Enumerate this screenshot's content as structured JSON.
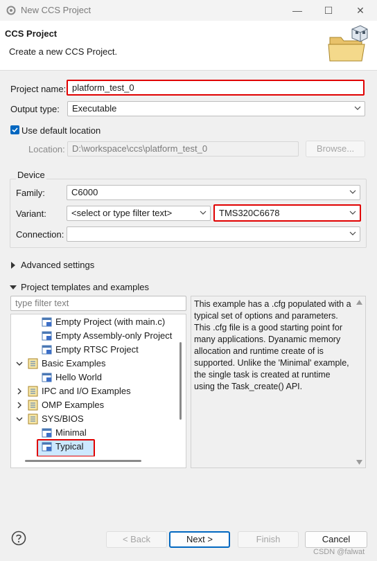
{
  "window": {
    "title": "New CCS Project",
    "minimize_label": "—",
    "maximize_label": "☐",
    "close_label": "✕",
    "app_icon": "eclipse-gear-icon"
  },
  "header": {
    "title": "CCS Project",
    "subtitle": "Create a new CCS Project.",
    "banner_icon": "folder-cube-icon"
  },
  "project": {
    "name_label": "Project name:",
    "name_value": "platform_test_0",
    "output_type_label": "Output type:",
    "output_type_value": "Executable",
    "use_default_location_label": "Use default location",
    "use_default_location_checked": true,
    "location_label": "Location:",
    "location_value": "D:\\workspace\\ccs\\platform_test_0",
    "browse_label": "Browse..."
  },
  "device": {
    "group_label": "Device",
    "family_label": "Family:",
    "family_value": "C6000",
    "variant_label": "Variant:",
    "variant_filter_placeholder": "<select or type filter text>",
    "variant_value": "TMS320C6678",
    "connection_label": "Connection:",
    "connection_value": ""
  },
  "sections": {
    "advanced_settings": "Advanced settings",
    "templates": "Project templates and examples"
  },
  "templates": {
    "filter_placeholder": "type filter text",
    "items": [
      {
        "label": "Empty Project (with main.c)",
        "kind": "leaf",
        "depth": 2
      },
      {
        "label": "Empty Assembly-only Project",
        "kind": "leaf",
        "depth": 2
      },
      {
        "label": "Empty RTSC Project",
        "kind": "leaf",
        "depth": 2
      },
      {
        "label": "Basic Examples",
        "kind": "folder",
        "depth": 1,
        "expanded": true
      },
      {
        "label": "Hello World",
        "kind": "leaf",
        "depth": 2
      },
      {
        "label": "IPC and I/O Examples",
        "kind": "folder",
        "depth": 1,
        "expanded": false
      },
      {
        "label": "OMP Examples",
        "kind": "folder",
        "depth": 1,
        "expanded": false
      },
      {
        "label": "SYS/BIOS",
        "kind": "folder",
        "depth": 1,
        "expanded": true
      },
      {
        "label": "Minimal",
        "kind": "leaf",
        "depth": 2
      },
      {
        "label": "Typical",
        "kind": "leaf",
        "depth": 2,
        "selected": true
      }
    ],
    "description": "This example has a .cfg populated with a typical set of options and parameters.  This .cfg file is a good starting point for many applications. Dyanamic memory allocation and runtime create of is supported.  Unlike the 'Minimal' example, the single task is created at runtime using the Task_create() API."
  },
  "footer": {
    "help_icon": "help-question-icon",
    "back_label": "< Back",
    "next_label": "Next >",
    "finish_label": "Finish",
    "cancel_label": "Cancel",
    "watermark": "CSDN @falwat"
  },
  "colors": {
    "highlight": "#e00000",
    "accent": "#0067c0",
    "selection": "#cce8ff"
  }
}
